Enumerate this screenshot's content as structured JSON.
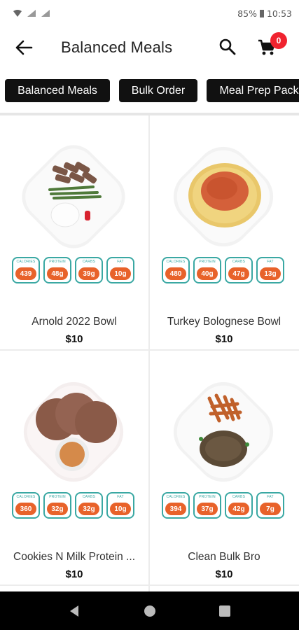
{
  "status_bar": {
    "battery": "85%",
    "time": "10:53"
  },
  "header": {
    "title": "Balanced Meals",
    "cart_count": "0"
  },
  "icons": {
    "back": "arrow-left-icon",
    "search": "search-icon",
    "cart": "cart-icon"
  },
  "chips": [
    "Balanced Meals",
    "Bulk Order",
    "Meal Prep Pack"
  ],
  "nutrition_labels": {
    "calories": "CALORIES",
    "protein": "PROTEIN",
    "carbs": "CARBS",
    "fat": "FAT"
  },
  "meals": [
    {
      "name": "Arnold 2022 Bowl",
      "price": "$10",
      "calories": "439",
      "protein": "48g",
      "carbs": "39g",
      "fat": "10g"
    },
    {
      "name": "Turkey Bolognese Bowl",
      "price": "$10",
      "calories": "480",
      "protein": "40g",
      "carbs": "47g",
      "fat": "13g"
    },
    {
      "name": "Cookies N Milk Protein ...",
      "price": "$10",
      "calories": "360",
      "protein": "32g",
      "carbs": "32g",
      "fat": "10g"
    },
    {
      "name": "Clean Bulk Bro",
      "price": "$10",
      "calories": "394",
      "protein": "37g",
      "carbs": "42g",
      "fat": "7g"
    }
  ],
  "colors": {
    "accent": "#e8622a",
    "badge_border": "#3aa8a3",
    "cart_badge": "#f0232f",
    "chip_bg": "#111111"
  }
}
